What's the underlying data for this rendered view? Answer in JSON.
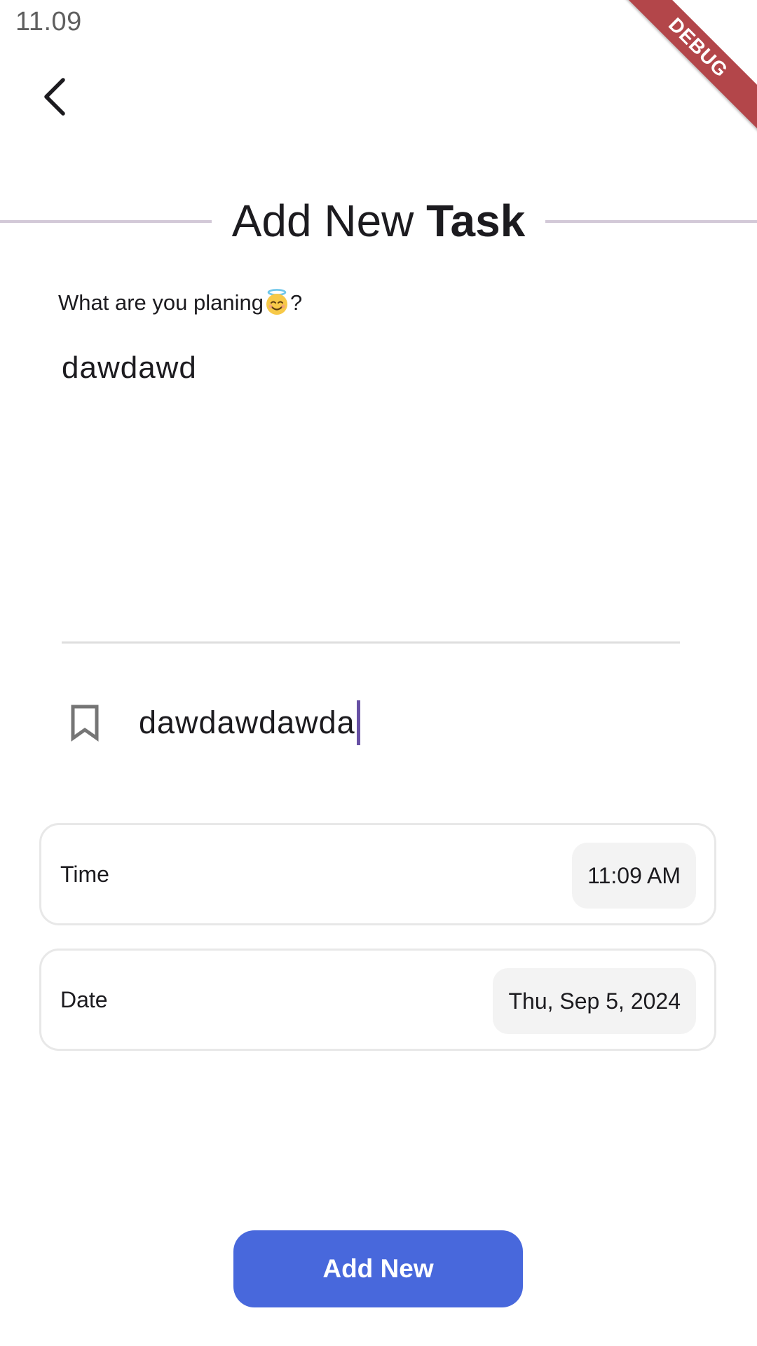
{
  "status_bar": {
    "time": "11.09"
  },
  "debug_banner": {
    "label": "DEBUG",
    "color": "#b3464a"
  },
  "header": {
    "back_icon": "chevron-left-icon",
    "title_regular": "Add New ",
    "title_bold": "Task"
  },
  "description_field": {
    "label_text": "What are you planing",
    "label_emoji_icon": "smiling-face-with-halo-icon",
    "label_suffix": "?",
    "value": "dawdawd"
  },
  "title_field": {
    "icon": "bookmark-icon",
    "value": "dawdawdawda"
  },
  "time_picker": {
    "label": "Time",
    "value": "11:09 AM"
  },
  "date_picker": {
    "label": "Date",
    "value": "Thu, Sep 5, 2024"
  },
  "submit": {
    "label": "Add New",
    "color": "#4868dc"
  },
  "colors": {
    "accent": "#4868dc",
    "caret": "#6750a4",
    "divider": "#d3c9d8"
  }
}
